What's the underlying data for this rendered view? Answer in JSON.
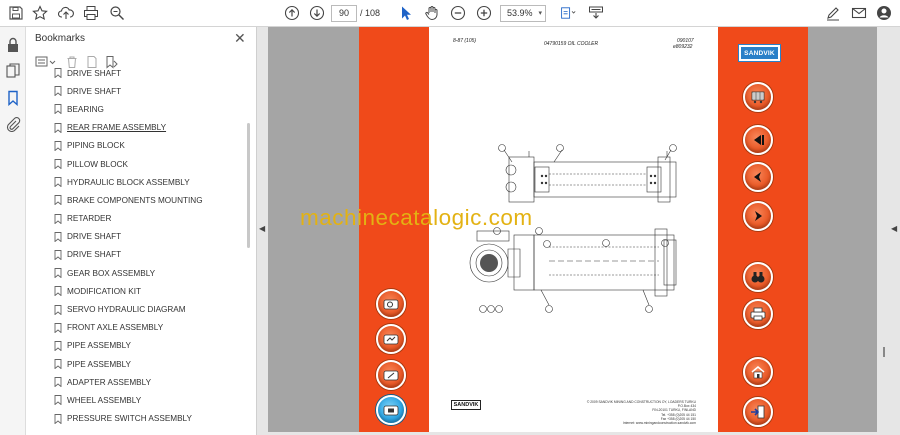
{
  "toolbar": {
    "page_current": "90",
    "page_total": "/ 108",
    "zoom": "53.9%"
  },
  "bookmarks": {
    "title": "Bookmarks",
    "items": [
      "DRIVE SHAFT",
      "DRIVE SHAFT",
      "BEARING",
      "REAR FRAME ASSEMBLY",
      "PIPING BLOCK",
      "PILLOW BLOCK",
      "HYDRAULIC BLOCK ASSEMBLY",
      "BRAKE COMPONENTS MOUNTING",
      "RETARDER",
      "DRIVE SHAFT",
      "DRIVE SHAFT",
      "GEAR BOX ASSEMBLY",
      "MODIFICATION KIT",
      "SERVO HYDRAULIC DIAGRAM",
      "FRONT AXLE ASSEMBLY",
      "PIPE ASSEMBLY",
      "PIPE ASSEMBLY",
      "ADAPTER ASSEMBLY",
      "WHEEL ASSEMBLY",
      "PRESSURE SWITCH ASSEMBLY"
    ]
  },
  "document": {
    "page_ref": "8-87 (105)",
    "drawing_title": "04790159 OIL COOLER",
    "date": "090107",
    "ref": "e809232",
    "brand": "SANDVIK",
    "footer_line1": "© 2009 SANDVIK MINING AND CONSTRUCTION OY, LOADERS TURKU",
    "footer_line2": "P.O.Box 434",
    "footer_line3": "FIN-20101 TURKU, FINLAND",
    "footer_line4": "Tel. +358 (0)205 44 151",
    "footer_line5": "Fax +358 (0)205 44 150",
    "footer_line6": "Internet: www.miningandconstruction.sandvik.com",
    "watermark": "machinecatalogic.com"
  },
  "colors": {
    "strip": "#f04a1a",
    "background": "#a5a5a5",
    "sandvik_blue": "#2a80c8",
    "watermark": "#e3b213"
  }
}
